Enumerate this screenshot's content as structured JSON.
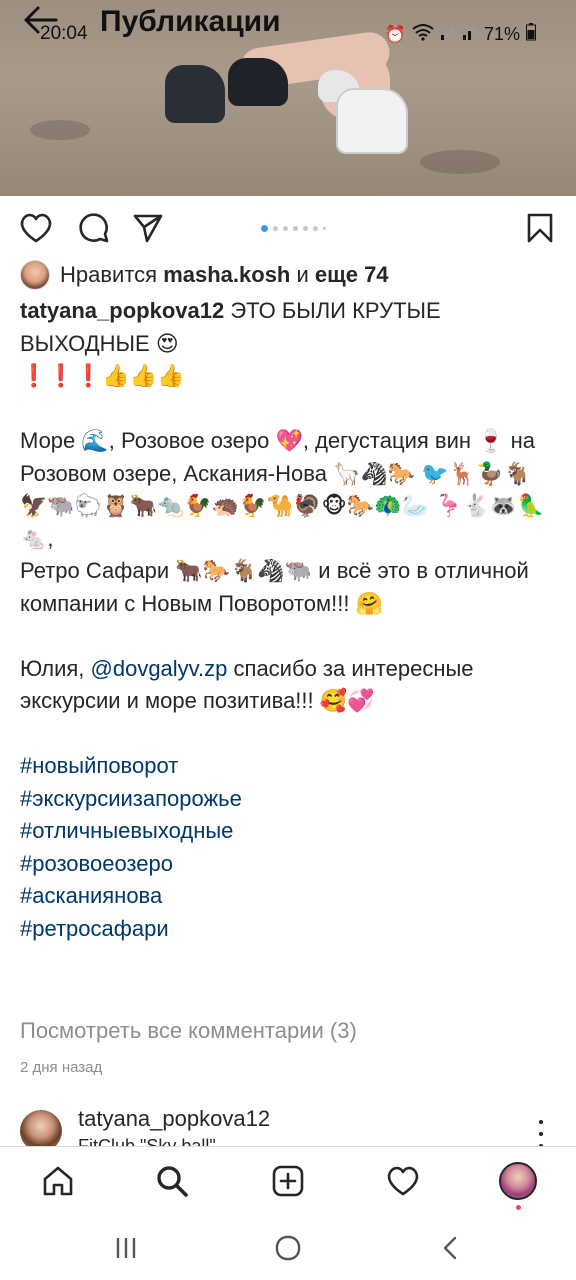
{
  "header": {
    "title": "Публикации",
    "back_icon": "back-arrow-icon"
  },
  "status_bar": {
    "time": "20:04",
    "battery": "71%",
    "icons": [
      "alarm-icon",
      "wifi-icon",
      "signal-icon",
      "signal-icon",
      "battery-icon"
    ]
  },
  "post": {
    "carousel": {
      "total": 7,
      "active_index": 0
    },
    "likes": {
      "prefix": "Нравится",
      "user": "masha.kosh",
      "and": "и",
      "others": "еще 74"
    },
    "caption": {
      "username": "tatyana_popkova12",
      "line1_text": "ЭТО БЫЛИ КРУТЫЕ ВЫХОДНЫЕ 😍",
      "line2": "❗❗❗👍👍👍",
      "para2": "Море 🌊, Розовое озеро 💖, дегустация вин 🍷 на Розовом озере, Аскания-Нова 🦙🦓🐎 🐦🦌🦆🐐🦅🐃🐑🦉🐂🐀🐓🦔🐓🐪🦃🐵🐎🦚🦢 🦩🐇🦝🦜🐁,",
      "para3": "Ретро Сафари 🐂🐎🐐🦓🐃 и всё это в отличной компании с Новым Поворотом!!! 🤗",
      "para4_before": "Юлия,",
      "para4_mention": "@dovgalyv.zp",
      "para4_after": "спасибо за интересные экскурсии и море позитива!!! 🥰💞",
      "hashtags": [
        "#новыйповорот",
        "#экскурсиизапорожье",
        "#отличныевыходные",
        "#розовоеозеро",
        "#асканиянова",
        "#ретросафари"
      ]
    },
    "view_all_comments": "Посмотреть все комментарии (3)",
    "date": "2 дня назад"
  },
  "next_post": {
    "username": "tatyana_popkova12",
    "subtitle": "FitClub \"Sky ball\""
  },
  "bottom_nav": [
    "home-icon",
    "search-icon",
    "new-post-icon",
    "activity-icon",
    "profile-icon"
  ],
  "system_nav": [
    "recent-apps-icon",
    "home-circle-icon",
    "back-chevron-icon"
  ],
  "colors": {
    "link": "#00376b",
    "accent": "#3897f0",
    "muted": "#8e8e8e",
    "text": "#262626"
  }
}
